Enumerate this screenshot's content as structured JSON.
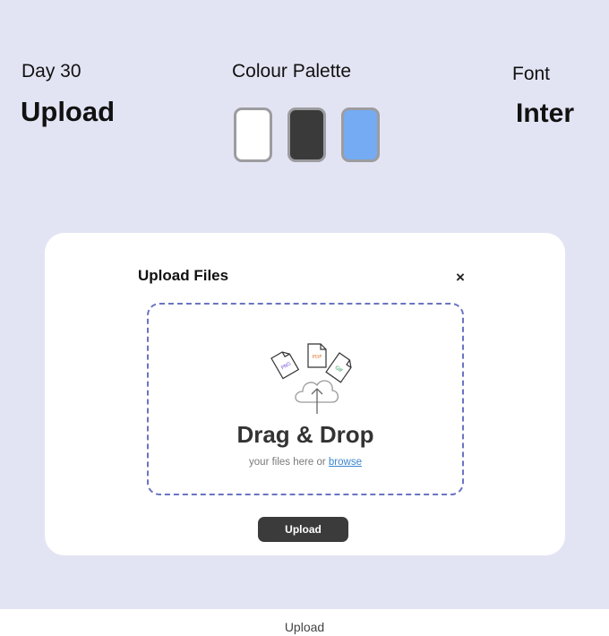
{
  "header": {
    "day": "Day 30",
    "title": "Upload",
    "palette_label": "Colour Palette",
    "font_label": "Font",
    "font_name": "Inter"
  },
  "palette": {
    "colors": [
      "#ffffff",
      "#3a3a3b",
      "#74abf2"
    ]
  },
  "dialog": {
    "title": "Upload Files",
    "close_glyph": "×",
    "drop_title": "Drag & Drop",
    "drop_sub_prefix": "your files here or",
    "browse_link": "browse",
    "file_types": [
      "PNG",
      "PDF",
      "GIF"
    ],
    "file_colors": [
      "#7b5cd6",
      "#e07b2e",
      "#2e9a57"
    ],
    "upload_button": "Upload"
  },
  "caption": "Upload"
}
